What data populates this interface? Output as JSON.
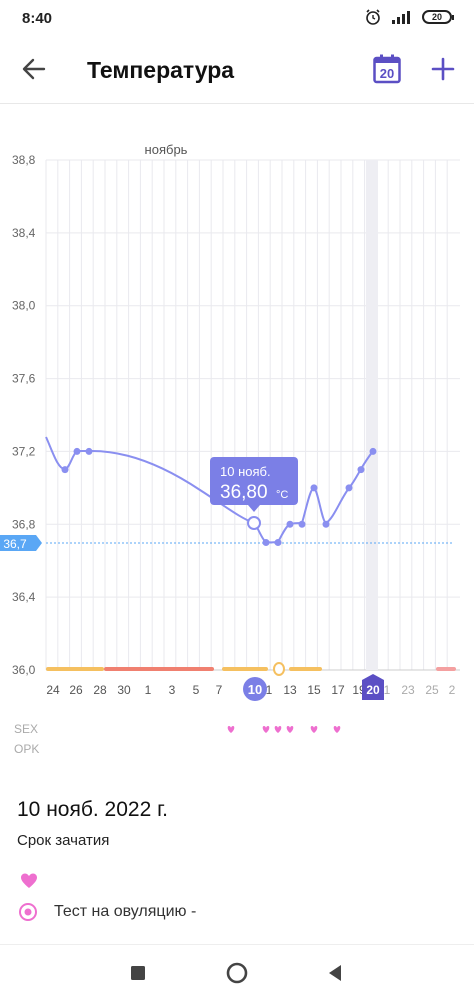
{
  "status_bar": {
    "time": "8:40",
    "battery": "20"
  },
  "app_bar": {
    "title": "Температура",
    "calendar_day": "20"
  },
  "chart_data": {
    "type": "line",
    "title": "ноябрь",
    "xlabel": "",
    "ylabel": "",
    "y_ticks": [
      "38,8",
      "38,4",
      "38,0",
      "37,6",
      "37,2",
      "36,8",
      "36,4",
      "36,0"
    ],
    "ylim": [
      36.0,
      38.8
    ],
    "x_tick_labels": [
      "24",
      "26",
      "28",
      "30",
      "1",
      "3",
      "5",
      "7",
      "10",
      "1",
      "13",
      "15",
      "17",
      "19",
      "20",
      "1",
      "23",
      "25",
      "2"
    ],
    "series": [
      {
        "x": [
          "24 окт",
          "25 окт",
          "26 окт",
          "27 окт",
          "10 нояб",
          "11 нояб",
          "12 нояб",
          "13 нояб",
          "14 нояб",
          "15 нояб",
          "16 нояб",
          "17 нояб",
          "18 нояб",
          "19 нояб",
          "20 нояб"
        ],
        "values": [
          37.27,
          37.1,
          37.2,
          37.2,
          36.8,
          36.7,
          36.7,
          36.8,
          36.8,
          37.0,
          36.8,
          36.9,
          37.0,
          37.1,
          37.2
        ]
      }
    ],
    "coverline": {
      "label": "36,7",
      "value": 36.7
    },
    "tooltip": {
      "date": "10 нояб.",
      "value": "36,80",
      "unit": "°C"
    },
    "selected_day": "10",
    "today_day": "20",
    "row_labels": [
      "SEX",
      "OPK"
    ],
    "colors": {
      "line": "#8a8ff0",
      "accent": "#7b7fe6",
      "coverline": "#5aa7f5",
      "today": "#5b4fc4",
      "period_bar": "#f08070",
      "fertile_bar": "#f5c060",
      "heart": "#ee6fcf"
    }
  },
  "details": {
    "date": "10 нояб. 2022 г.",
    "status": "Срок зачатия",
    "heart_icon": "heart-icon",
    "ovulation_test": "Тест на овуляцию -"
  }
}
